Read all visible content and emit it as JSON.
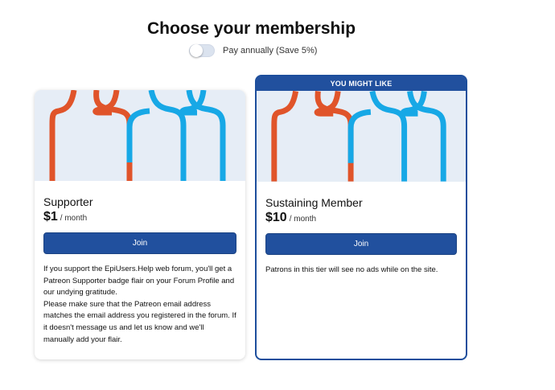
{
  "header": {
    "title": "Choose your membership",
    "toggle_label": "Pay annually (Save 5%)",
    "toggle_on": false
  },
  "colors": {
    "accent": "#21509e",
    "art_background": "#e6edf6",
    "figure_orange": "#e0542a",
    "figure_blue": "#17a8e6"
  },
  "tiers": [
    {
      "name": "Supporter",
      "price": "$1",
      "period": "/ month",
      "join_label": "Join",
      "description": [
        "If you support the EpiUsers.Help web forum, you'll get a Patreon Supporter badge flair on your Forum Profile and our undying gratitude.",
        "Please make sure that the Patreon email address matches the email address you registered in the forum. If it doesn't message us and let us know and we'll manually add your flair."
      ]
    },
    {
      "badge": "YOU MIGHT LIKE",
      "name": "Sustaining Member",
      "price": "$10",
      "period": "/ month",
      "join_label": "Join",
      "description": [
        "Patrons in this tier will see no ads while on the site."
      ]
    }
  ]
}
